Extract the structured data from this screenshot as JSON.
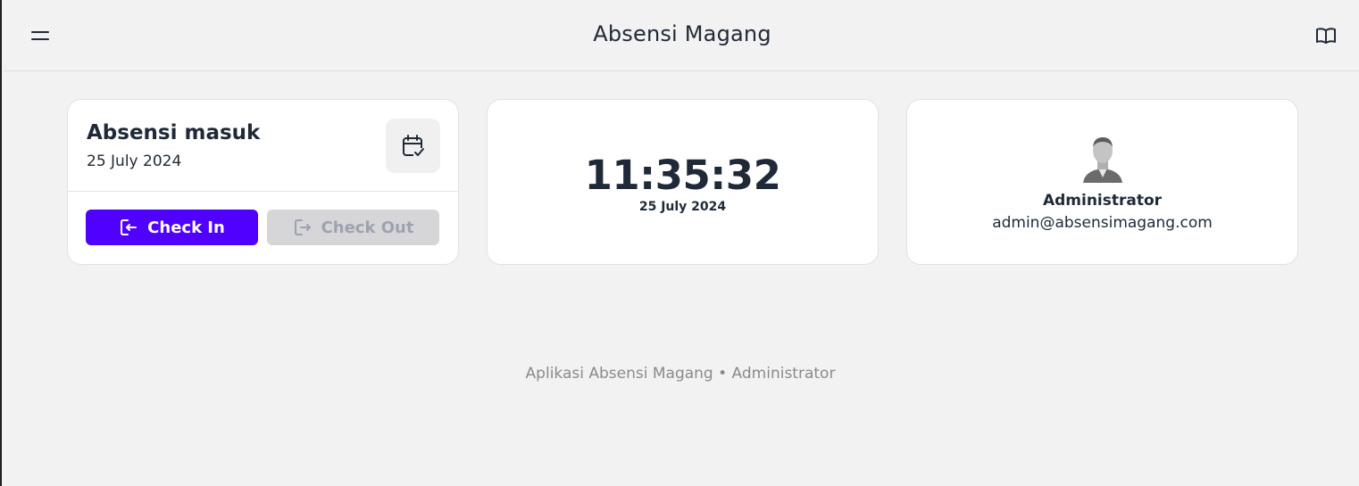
{
  "header": {
    "title": "Absensi Magang",
    "menu_icon": "hamburger-icon",
    "book_icon": "book-icon"
  },
  "attendance_card": {
    "title": "Absensi masuk",
    "date": "25 July 2024",
    "calendar_icon": "calendar-check-icon",
    "check_in_label": "Check In",
    "check_out_label": "Check Out"
  },
  "clock_card": {
    "time": "11:35:32",
    "date": "25 July 2024"
  },
  "user_card": {
    "name": "Administrator",
    "email": "admin@absensimagang.com"
  },
  "footer": {
    "text": "Aplikasi Absensi Magang • Administrator"
  },
  "colors": {
    "accent": "#4f00ff",
    "background": "#f2f2f2",
    "disabled": "#d6d6d9"
  }
}
